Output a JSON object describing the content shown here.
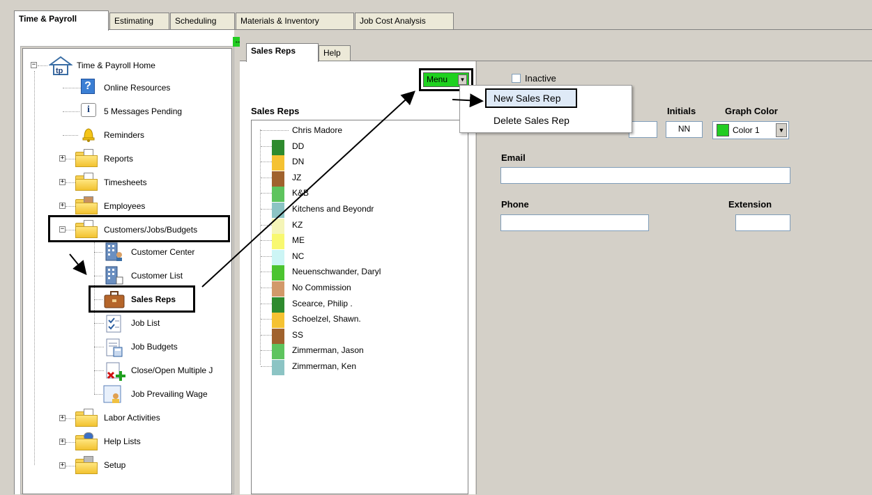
{
  "top_tabs": [
    "Time & Payroll",
    "Estimating",
    "Scheduling",
    "Materials & Inventory",
    "Job Cost Analysis"
  ],
  "splitter_icon": "resize-horizontal-icon",
  "tree": {
    "home": "Time & Payroll Home",
    "online_resources": "Online Resources",
    "messages": "5 Messages Pending",
    "reminders": "Reminders",
    "reports": "Reports",
    "timesheets": "Timesheets",
    "employees": "Employees",
    "customers": "Customers/Jobs/Budgets",
    "customer_center": "Customer Center",
    "customer_list": "Customer List",
    "sales_reps": "Sales Reps",
    "job_list": "Job List",
    "job_budgets": "Job Budgets",
    "close_open": "Close/Open Multiple J",
    "prevailing_wage": "Job Prevailing Wage",
    "labor_activities": "Labor Activities",
    "help_lists": "Help Lists",
    "setup": "Setup"
  },
  "sub_tabs": [
    "Sales Reps",
    "Help"
  ],
  "list_heading": "Sales Reps",
  "sales_reps": [
    {
      "name": "Chris Madore",
      "color": ""
    },
    {
      "name": "DD",
      "color": "#2e8b2e"
    },
    {
      "name": "DN",
      "color": "#f5c232"
    },
    {
      "name": "JZ",
      "color": "#a0622d"
    },
    {
      "name": "K&B",
      "color": "#5ec45e"
    },
    {
      "name": "Kitchens and Beyondr",
      "color": "#8cc4c4"
    },
    {
      "name": "KZ",
      "color": "#f5f5b8"
    },
    {
      "name": "ME",
      "color": "#f8f870"
    },
    {
      "name": "NC",
      "color": "#ccf5f5"
    },
    {
      "name": "Neuenschwander, Daryl",
      "color": "#4cc430"
    },
    {
      "name": "No Commission",
      "color": "#d2996a"
    },
    {
      "name": "Scearce, Philip .",
      "color": "#2e8b2e"
    },
    {
      "name": "Schoelzel, Shawn.",
      "color": "#f5c232"
    },
    {
      "name": "SS",
      "color": "#a0622d"
    },
    {
      "name": "Zimmerman, Jason",
      "color": "#5ec45e"
    },
    {
      "name": "Zimmerman, Ken",
      "color": "#8cc4c4"
    }
  ],
  "menu": {
    "label": "Menu",
    "items": [
      "New Sales Rep",
      "Delete Sales Rep"
    ]
  },
  "form": {
    "inactive_label": "Inactive",
    "initials_label": "Initials",
    "initials_value": "NN",
    "graph_color_label": "Graph Color",
    "graph_color_value": "Color 1",
    "graph_color_swatch": "#22cc22",
    "email_label": "Email",
    "email_value": "",
    "phone_label": "Phone",
    "phone_value": "",
    "extension_label": "Extension",
    "extension_value": ""
  }
}
